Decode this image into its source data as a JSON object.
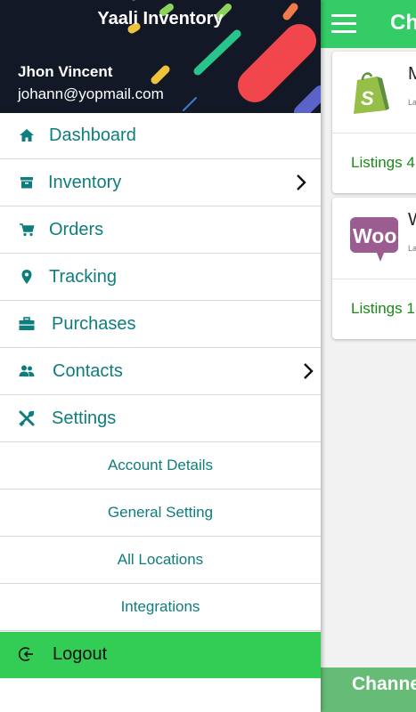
{
  "app": {
    "title": "Ch",
    "bottom_label": "Channe",
    "cards": [
      {
        "name": "M",
        "sub": "La",
        "listings": "Listings 4",
        "logo": "shopify-icon"
      },
      {
        "name": "W",
        "sub": "La",
        "listings": "Listings 1",
        "logo": "woocommerce-icon"
      }
    ]
  },
  "drawer": {
    "brand": "Yaali Inventory",
    "user_name": "Jhon Vincent",
    "user_email": "johann@yopmail.com",
    "menu": [
      {
        "label": "Dashboard",
        "icon": "home-icon"
      },
      {
        "label": "Inventory",
        "icon": "archive-icon",
        "chevron": true
      },
      {
        "label": "Orders",
        "icon": "cart-icon"
      },
      {
        "label": "Tracking",
        "icon": "location-pin-icon"
      },
      {
        "label": "Purchases",
        "icon": "briefcase-icon"
      },
      {
        "label": "Contacts",
        "icon": "users-icon",
        "chevron": true
      },
      {
        "label": "Settings",
        "icon": "tools-icon"
      }
    ],
    "submenu": [
      "Account Details",
      "General Setting",
      "All Locations",
      "Integrations"
    ],
    "logout": "Logout"
  },
  "colors": {
    "primary_green": "#33cc66",
    "teal": "#0e7d7d",
    "header_dark": "#111722",
    "logout_green": "#33cc55"
  }
}
